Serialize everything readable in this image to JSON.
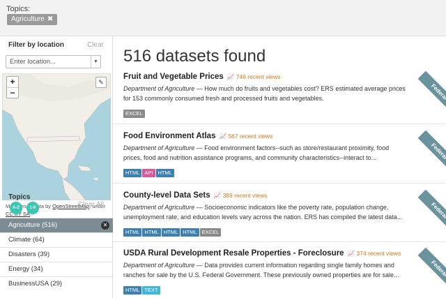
{
  "topbar": {
    "label": "Topics:",
    "chip": "Agriculture",
    "chip_x": "✖"
  },
  "location": {
    "heading": "Filter by location",
    "clear": "Clear",
    "placeholder": "Enter location..."
  },
  "map": {
    "zoom_in": "+",
    "zoom_out": "−",
    "edit_icon": "pencil-icon",
    "attribution_pre": "Map tiles & Data by ",
    "attribution_link": "OpenStreetMap",
    "attribution_mid": ", under ",
    "attribution_license": "CC BY SA",
    "attribution_end": "."
  },
  "topics": {
    "heading": "Topics",
    "sort_az": "A-Z",
    "sort_19": "1-9",
    "clear_all": "Clear All",
    "items": [
      {
        "label": "Agriculture (516)",
        "active": true
      },
      {
        "label": "Climate (64)"
      },
      {
        "label": "Disasters (39)"
      },
      {
        "label": "Energy (34)"
      },
      {
        "label": "BusinessUSA (29)"
      }
    ]
  },
  "results": {
    "count": "516 datasets found",
    "badge": "Federal",
    "colors": {
      "HTML": "#3d7fae",
      "API": "#d65a9b",
      "EXCEL": "#8a8a8a",
      "TEXT": "#42b7d6"
    },
    "datasets": [
      {
        "title": "Fruit and Vegetable Prices",
        "views": "746 recent views",
        "dept": "Department of Agriculture",
        "desc": " — How much do fruits and vegetables cost? ERS estimated average prices for 153 commonly consumed fresh and processed fruits and vegetables.",
        "formats": [
          "EXCEL"
        ]
      },
      {
        "title": "Food Environment Atlas",
        "views": "567 recent views",
        "dept": "Department of Agriculture",
        "desc": " — Food environment factors--such as store/restaurant proximity, food prices, food and nutrition assistance programs, and community characteristics--interact to...",
        "formats": [
          "HTML",
          "API",
          "HTML"
        ]
      },
      {
        "title": "County-level Data Sets",
        "views": "389 recent views",
        "dept": "Department of Agriculture",
        "desc": " — Socioeconomic indicators like the poverty rate, population change, unemployment rate, and education levels vary across the nation. ERS has compiled the latest data...",
        "formats": [
          "HTML",
          "HTML",
          "HTML",
          "HTML",
          "EXCEL"
        ]
      },
      {
        "title": "USDA Rural Development Resale Properties - Foreclosure",
        "views": "374 recent views",
        "dept": "Department of Agriculture",
        "desc": " — Data provides current information regarding single family homes and ranches for sale by the U.S. Federal Government. These previously owned properties are for sale...",
        "formats": [
          "HTML",
          "TEXT"
        ]
      }
    ]
  }
}
